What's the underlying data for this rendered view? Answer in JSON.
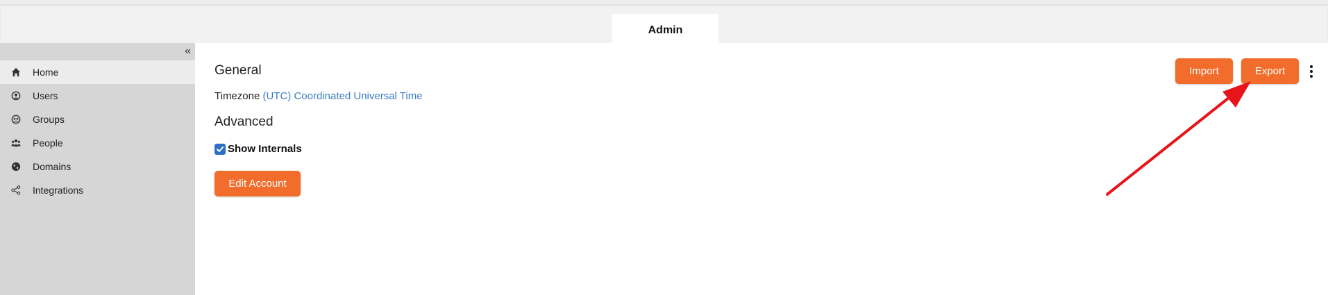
{
  "header": {
    "tab_label": "Admin"
  },
  "sidebar": {
    "collapse_icon": "«",
    "items": [
      {
        "label": "Home",
        "icon": "home-icon"
      },
      {
        "label": "Users",
        "icon": "user-circle-icon"
      },
      {
        "label": "Groups",
        "icon": "groups-icon"
      },
      {
        "label": "People",
        "icon": "people-icon"
      },
      {
        "label": "Domains",
        "icon": "globe-icon"
      },
      {
        "label": "Integrations",
        "icon": "share-nodes-icon"
      }
    ],
    "active_item": "Home"
  },
  "main": {
    "general_heading": "General",
    "timezone_label": "Timezone",
    "timezone_value": "(UTC) Coordinated Universal Time",
    "advanced_heading": "Advanced",
    "show_internals_label": "Show Internals",
    "show_internals_checked": true,
    "edit_account_label": "Edit Account"
  },
  "toolbar": {
    "import_label": "Import",
    "export_label": "Export",
    "more_icon": "vertical-ellipsis-icon"
  },
  "colors": {
    "accent_orange": "#f26c2c",
    "link_blue": "#3b7dc4",
    "sidebar_bg": "#d6d6d6",
    "annotation_red": "#e8141b"
  }
}
